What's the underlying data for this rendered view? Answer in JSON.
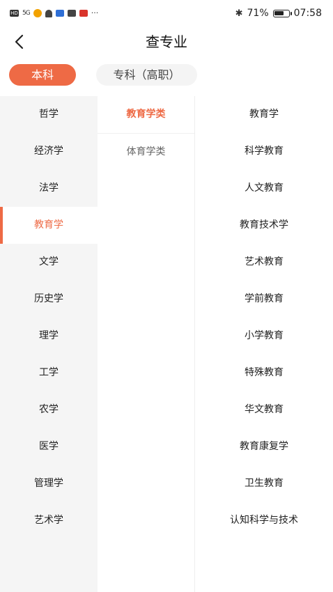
{
  "status_bar": {
    "battery_percent": "71%",
    "battery_level": 0.71,
    "time": "07:58",
    "signal": "5G",
    "icons": [
      "hd-icon",
      "signal-icon",
      "eye-icon",
      "bell-icon",
      "app-blue-icon",
      "app-dark-icon",
      "app-red-icon"
    ],
    "more": "···"
  },
  "header": {
    "title": "查专业"
  },
  "degree_tabs": [
    {
      "label": "本科",
      "active": true
    },
    {
      "label": "专科（高职）",
      "active": false
    }
  ],
  "colors": {
    "accent": "#ee6a45",
    "sidebar_bg": "#f5f5f5"
  },
  "disciplines": [
    {
      "label": "哲学"
    },
    {
      "label": "经济学"
    },
    {
      "label": "法学"
    },
    {
      "label": "教育学",
      "active": true
    },
    {
      "label": "文学"
    },
    {
      "label": "历史学"
    },
    {
      "label": "理学"
    },
    {
      "label": "工学"
    },
    {
      "label": "农学"
    },
    {
      "label": "医学"
    },
    {
      "label": "管理学"
    },
    {
      "label": "艺术学"
    }
  ],
  "categories": [
    {
      "label": "教育学类",
      "active": true
    },
    {
      "label": "体育学类"
    }
  ],
  "majors": [
    {
      "label": "教育学"
    },
    {
      "label": "科学教育"
    },
    {
      "label": "人文教育"
    },
    {
      "label": "教育技术学"
    },
    {
      "label": "艺术教育"
    },
    {
      "label": "学前教育"
    },
    {
      "label": "小学教育"
    },
    {
      "label": "特殊教育"
    },
    {
      "label": "华文教育"
    },
    {
      "label": "教育康复学"
    },
    {
      "label": "卫生教育"
    },
    {
      "label": "认知科学与技术"
    }
  ]
}
